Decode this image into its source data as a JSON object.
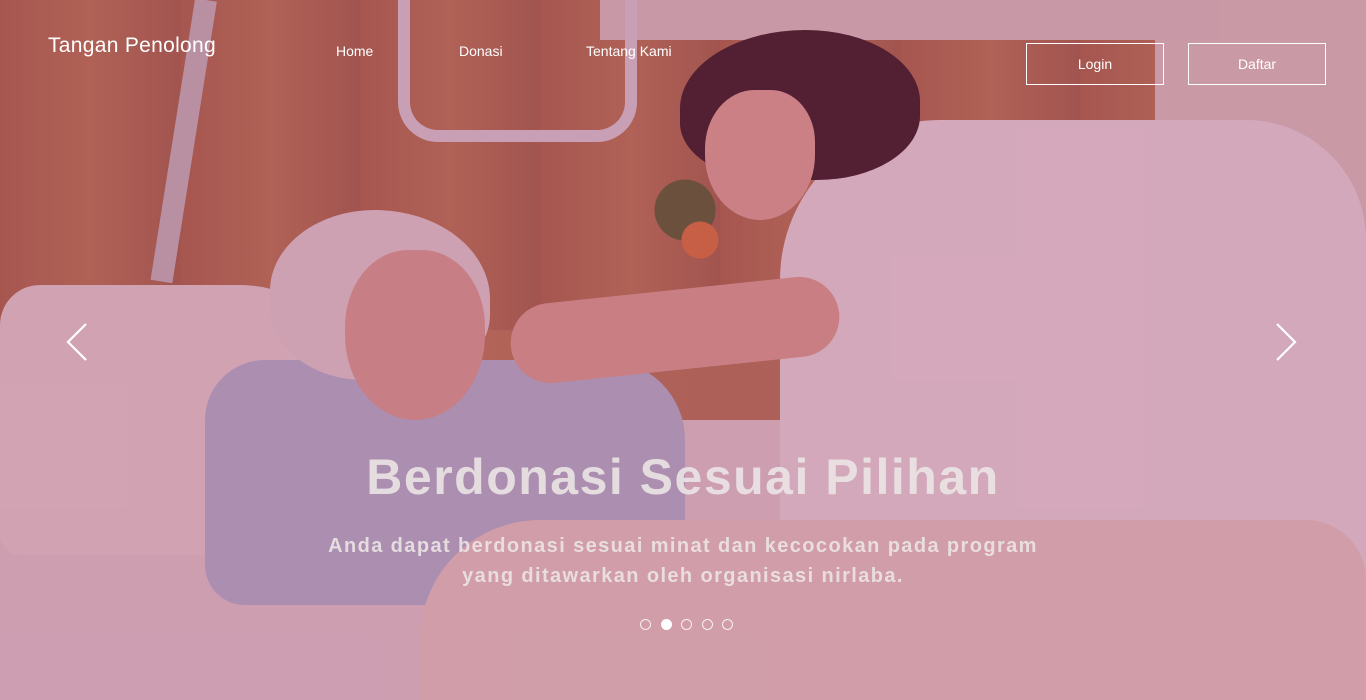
{
  "brand": {
    "name": "Tangan Penolong"
  },
  "nav": {
    "items": [
      {
        "label": "Home"
      },
      {
        "label": "Donasi"
      },
      {
        "label": "Tentang Kami"
      }
    ],
    "login_label": "Login",
    "register_label": "Daftar"
  },
  "carousel": {
    "title": "Berdonasi Sesuai Pilihan",
    "text_line1": "Anda dapat berdonasi sesuai minat dan kecocokan pada program",
    "text_line2": "yang ditawarkan oleh organisasi nirlaba.",
    "prev_icon": "chevron-left-icon",
    "next_icon": "chevron-right-icon",
    "slide_count": 5,
    "active_slide": 2
  },
  "colors": {
    "overlay": "#96285a",
    "text": "#ffffff"
  }
}
